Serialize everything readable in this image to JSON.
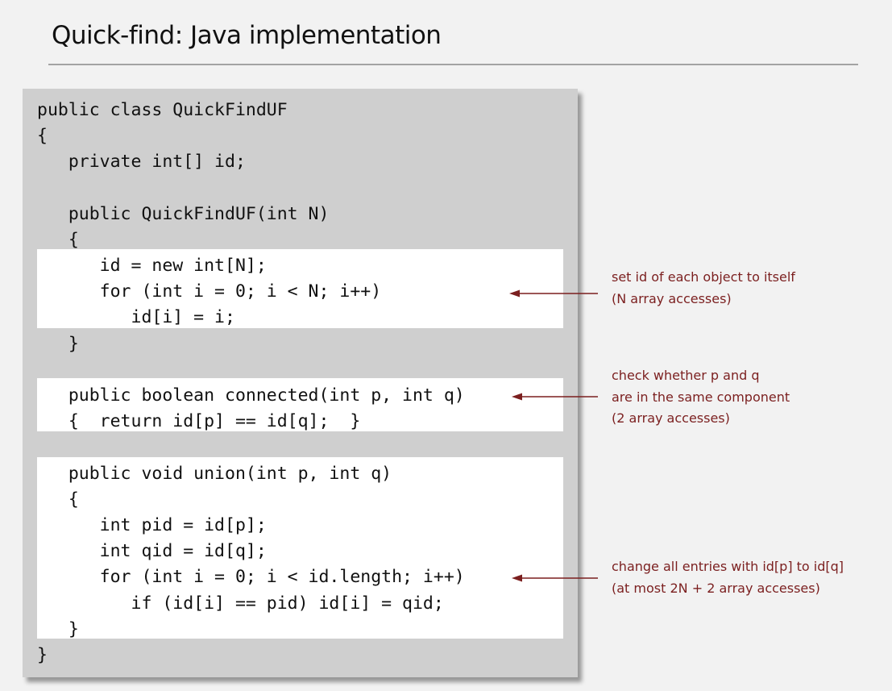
{
  "title": "Quick-find:  Java implementation",
  "code_lines": [
    "public class QuickFindUF",
    "{",
    "   private int[] id;",
    "",
    "   public QuickFindUF(int N)",
    "   {",
    "      id = new int[N];",
    "      for (int i = 0; i < N; i++)",
    "         id[i] = i;",
    "   }",
    "",
    "   public boolean connected(int p, int q)",
    "   {  return id[p] == id[q];  }",
    "",
    "   public void union(int p, int q)",
    "   {",
    "      int pid = id[p];",
    "      int qid = id[q];",
    "      for (int i = 0; i < id.length; i++)",
    "         if (id[i] == pid) id[i] = qid;",
    "   }",
    "}"
  ],
  "annotations": {
    "init": [
      "set id of each object to itself",
      "(N array accesses)"
    ],
    "connected": [
      "check whether p and q",
      "are in the same component",
      "(2 array accesses)"
    ],
    "union": [
      "change all entries with id[p] to id[q]",
      "(at most 2N + 2 array accesses)"
    ]
  },
  "colors": {
    "annotation_text": "#7b1f1f",
    "arrow": "#7b1f1f",
    "code_panel": "#cfcfcf",
    "highlight": "#ffffff",
    "background": "#f2f2f2"
  }
}
